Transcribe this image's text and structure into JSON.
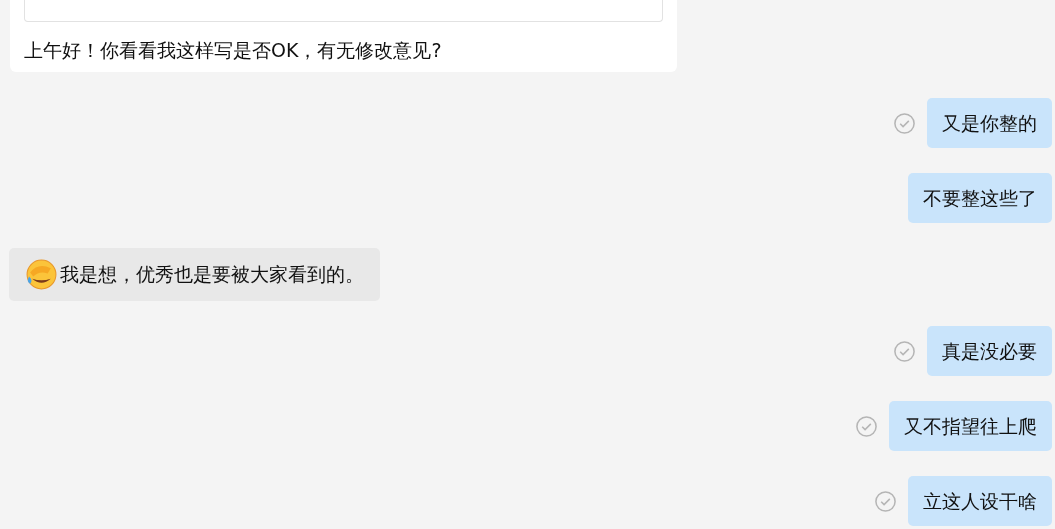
{
  "top_message": {
    "text": "上午好！你看看我这样写是否OK，有无修改意见?"
  },
  "messages": [
    {
      "kind": "outgoing",
      "text": "又是你整的",
      "tick": true
    },
    {
      "kind": "outgoing",
      "text": "不要整这些了",
      "tick": false
    },
    {
      "kind": "incoming",
      "text": "我是想，优秀也是要被大家看到的。",
      "emoji": true
    },
    {
      "kind": "outgoing",
      "text": "真是没必要",
      "tick": true
    },
    {
      "kind": "outgoing",
      "text": "又不指望往上爬",
      "tick": true
    },
    {
      "kind": "outgoing",
      "text": "立这人设干啥",
      "tick": true
    }
  ]
}
